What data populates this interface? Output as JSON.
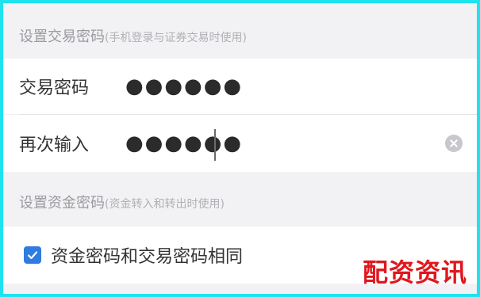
{
  "section_trade": {
    "title": "设置交易密码",
    "subtitle": "(手机登录与证券交易时使用)"
  },
  "trade_password": {
    "label": "交易密码",
    "value": "●●●●●●"
  },
  "confirm_password": {
    "label": "再次输入",
    "value": "●●●●●●"
  },
  "section_fund": {
    "title": "设置资金密码",
    "subtitle": "(资金转入和转出时使用)"
  },
  "same_password": {
    "label": "资金密码和交易密码相同",
    "checked": true
  },
  "watermark": "配资资讯",
  "colors": {
    "frame": "#1ee3ee",
    "accent": "#2f7be0",
    "watermark": "#e0171d"
  },
  "icons": {
    "clear": "clear-circle-icon",
    "check": "checkmark-icon"
  }
}
